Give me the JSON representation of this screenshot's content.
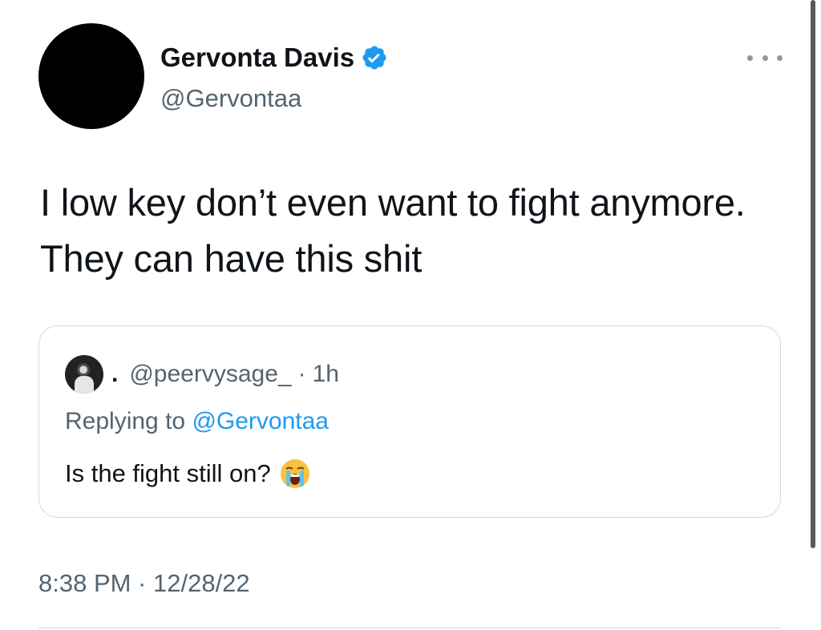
{
  "author": {
    "display_name": "Gervonta Davis",
    "handle": "@Gervontaa",
    "verified_icon": "verified-badge-icon"
  },
  "tweet": {
    "text": "I low key don’t even want to fight anymore. They can have this shit"
  },
  "quoted_tweet": {
    "name": ".",
    "handle": "@peervysage_",
    "separator": "·",
    "time": "1h",
    "replying_prefix": "Replying to",
    "replying_handle": "@Gervontaa",
    "text": "Is the fight still on?",
    "emoji": "loudly-crying-face"
  },
  "meta": {
    "timestamp": "8:38 PM · 12/28/22"
  },
  "icons": {
    "more": "more-options-icon"
  },
  "colors": {
    "accent": "#1d9bf0",
    "secondary_text": "#536471",
    "primary_text": "#0f1419",
    "border": "#cfd9de"
  }
}
